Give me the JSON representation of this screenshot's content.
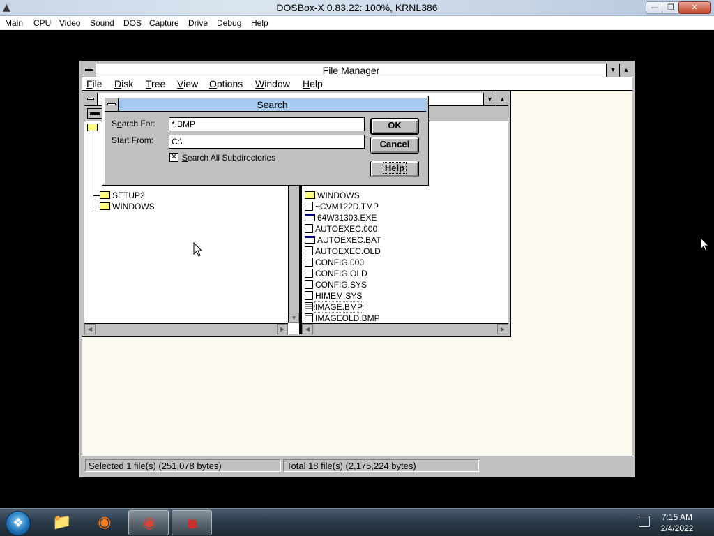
{
  "host": {
    "title": "DOSBox-X 0.83.22: 100%, KRNL386",
    "window_buttons": {
      "minimize": "—",
      "restore": "❐",
      "close": "✕"
    },
    "menu": [
      "Main",
      "CPU",
      "Video",
      "Sound",
      "DOS",
      "Capture",
      "Drive",
      "Debug",
      "Help"
    ]
  },
  "file_manager": {
    "title": "File Manager",
    "menu": [
      {
        "key": "F",
        "rest": "ile"
      },
      {
        "key": "D",
        "rest": "isk"
      },
      {
        "key": "T",
        "rest": "ree"
      },
      {
        "key": "V",
        "rest": "iew"
      },
      {
        "key": "O",
        "rest": "ptions"
      },
      {
        "key": "W",
        "rest": "indow"
      },
      {
        "key": "H",
        "rest": "elp"
      }
    ],
    "tree": {
      "items": [
        "SETUP2",
        "WINDOWS"
      ]
    },
    "files": [
      {
        "name": "WINDOWS",
        "type": "folder"
      },
      {
        "name": "~CVM122D.TMP",
        "type": "file"
      },
      {
        "name": "64W31303.EXE",
        "type": "exe"
      },
      {
        "name": "AUTOEXEC.000",
        "type": "file"
      },
      {
        "name": "AUTOEXEC.BAT",
        "type": "exe"
      },
      {
        "name": "AUTOEXEC.OLD",
        "type": "file"
      },
      {
        "name": "CONFIG.000",
        "type": "file"
      },
      {
        "name": "CONFIG.OLD",
        "type": "file"
      },
      {
        "name": "CONFIG.SYS",
        "type": "file"
      },
      {
        "name": "HIMEM.SYS",
        "type": "file"
      },
      {
        "name": "IMAGE.BMP",
        "type": "bmp",
        "selected": true
      },
      {
        "name": "IMAGEOLD.BMP",
        "type": "bmp"
      }
    ],
    "status": {
      "selected": "Selected 1 file(s) (251,078 bytes)",
      "total": "Total 18 file(s) (2,175,224 bytes)"
    }
  },
  "search_dialog": {
    "title": "Search",
    "search_for_label": {
      "pre": "S",
      "key": "e",
      "post": "arch For:"
    },
    "search_for_value": "*.BMP",
    "start_from_label": {
      "pre": "Start ",
      "key": "F",
      "post": "rom:"
    },
    "start_from_value": "C:\\",
    "subdirs_label": {
      "key": "S",
      "post": "earch All Subdirectories"
    },
    "subdirs_checked": true,
    "ok_label": "OK",
    "cancel_label": "Cancel",
    "help_label": {
      "key": "H",
      "post": "elp"
    }
  },
  "taskbar": {
    "time": "7:15 AM",
    "date": "2/4/2022",
    "apps": [
      "windows-explorer",
      "firefox",
      "chrome",
      "dosbox"
    ]
  }
}
